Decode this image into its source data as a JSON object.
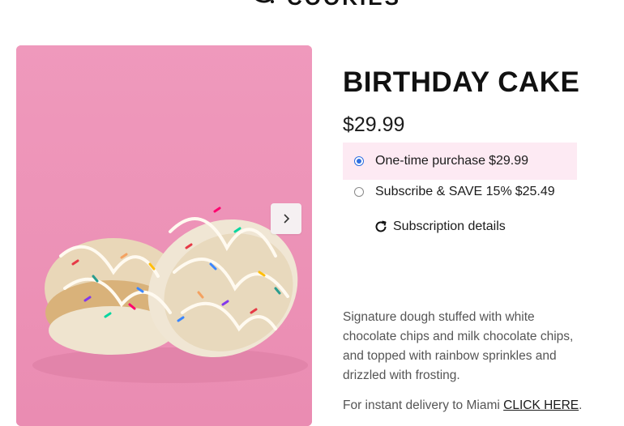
{
  "header": {
    "logo_text": "COOKIES"
  },
  "product": {
    "title": "BIRTHDAY CAKE",
    "price": "$29.99",
    "options": [
      {
        "label": "One-time purchase",
        "price": "$29.99",
        "selected": true
      },
      {
        "label": "Subscribe & SAVE 15%",
        "price": "$25.49",
        "selected": false
      }
    ],
    "subscription_details_label": "Subscription details",
    "description": "Signature dough stuffed with white chocolate chips and milk chocolate chips, and topped with rainbow sprinkles and drizzled with frosting.",
    "delivery_prefix": "For instant delivery to Miami",
    "delivery_link": "CLICK HERE",
    "delivery_suffix": "."
  },
  "gallery": {
    "image_alt": "Birthday cake cookies with rainbow sprinkles on pink background",
    "next_icon": "chevron-right-icon"
  },
  "colors": {
    "image_background": "#ee93b7",
    "selected_option_bg": "#fdeaf3",
    "radio_accent": "#2f6fe0"
  }
}
